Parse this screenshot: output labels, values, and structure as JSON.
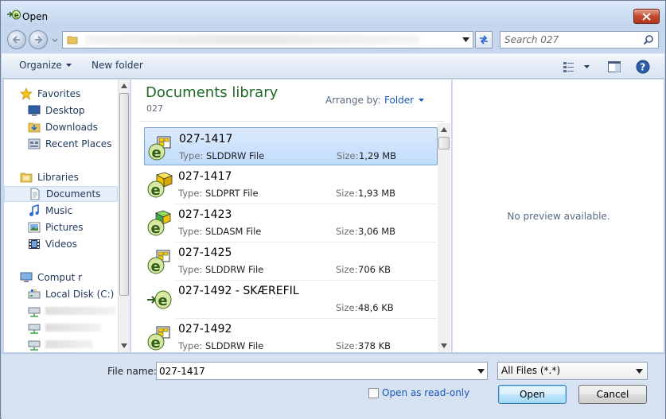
{
  "window": {
    "title": "Open",
    "close_glyph": "✕"
  },
  "address": {
    "path_text": "",
    "search_placeholder": "Search 027"
  },
  "toolbar": {
    "organize": "Organize",
    "new_folder": "New folder"
  },
  "nav": {
    "favorites_header": "Favorites",
    "favorites": [
      "Desktop",
      "Downloads",
      "Recent Places"
    ],
    "libraries_header": "Libraries",
    "libraries": [
      "Documents",
      "Music",
      "Pictures",
      "Videos"
    ],
    "computer_header": "Comput  r",
    "computer_items": [
      "Local Disk (C:)"
    ]
  },
  "library": {
    "title": "Documents library",
    "subtitle": "027",
    "arrange_label": "Arrange by:",
    "arrange_value": "Folder"
  },
  "labels": {
    "type": "Type:",
    "size": "Size:"
  },
  "files": [
    {
      "name": "027-1417",
      "type": "SLDDRW File",
      "size": "1,29 MB",
      "icon": "drawing-icon",
      "selected": true
    },
    {
      "name": "027-1417",
      "type": "SLDPRT File",
      "size": "1,93 MB",
      "icon": "part-icon",
      "selected": false
    },
    {
      "name": "027-1423",
      "type": "SLDASM File",
      "size": "3,06 MB",
      "icon": "assembly-icon",
      "selected": false
    },
    {
      "name": "027-1425",
      "type": "SLDDRW File",
      "size": "706 KB",
      "icon": "drawing-icon",
      "selected": false
    },
    {
      "name": "027-1492 - SKÆREFIL",
      "type": "",
      "size": "48,6 KB",
      "icon": "edrawing-icon",
      "selected": false
    },
    {
      "name": "027-1492",
      "type": "SLDDRW File",
      "size": "378 KB",
      "icon": "drawing-icon",
      "selected": false
    }
  ],
  "preview": {
    "text": "No preview available."
  },
  "bottom": {
    "file_name_label": "File name:",
    "file_name_value": "027-1417",
    "filter_value": "All Files (*.*)",
    "read_only_label": "Open as read-only",
    "open_button": "Open",
    "cancel_button": "Cancel"
  },
  "colors": {
    "accent": "#1a58b7",
    "library_title": "#1e6a24",
    "selection": "#c1dcfc"
  }
}
